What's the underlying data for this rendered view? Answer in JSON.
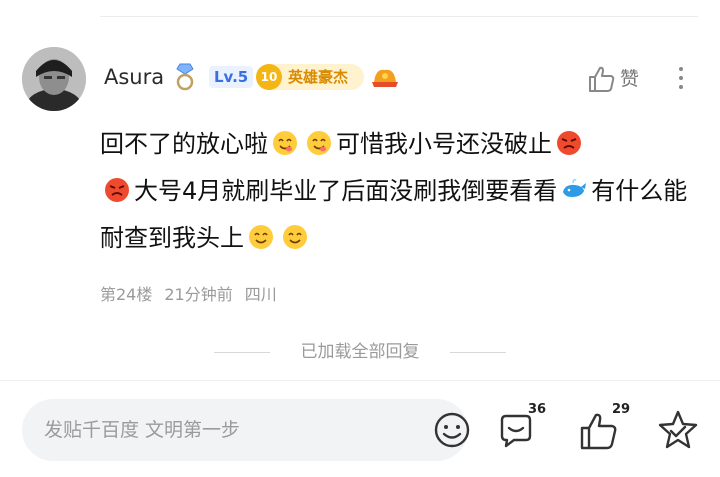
{
  "post": {
    "username": "Asura",
    "level": "Lv.5",
    "honor_level": "10",
    "honor_title": "英雄豪杰",
    "like_label": "赞",
    "comment_parts": [
      "回不了的放心啦",
      "可惜我小号还没破止",
      "大号4月就刷毕业了后面没刷我倒要看看",
      "有什么能耐查到我头上"
    ],
    "floor": "第24楼",
    "time": "21分钟前",
    "location": "四川"
  },
  "thread": {
    "all_loaded": "已加载全部回复"
  },
  "bottom_bar": {
    "input_placeholder": "发贴千百度 文明第一步",
    "comment_count": "36",
    "like_count": "29"
  },
  "icons": {
    "comment_emojis": [
      "yum-face",
      "yum-face",
      "angry-face",
      "angry-face",
      "whale",
      "smile-face",
      "smile-face"
    ]
  },
  "colors": {
    "level_badge": "#3a6fe0",
    "honor_badge": "#d88b00",
    "secondary_text": "#9a9a9a"
  }
}
